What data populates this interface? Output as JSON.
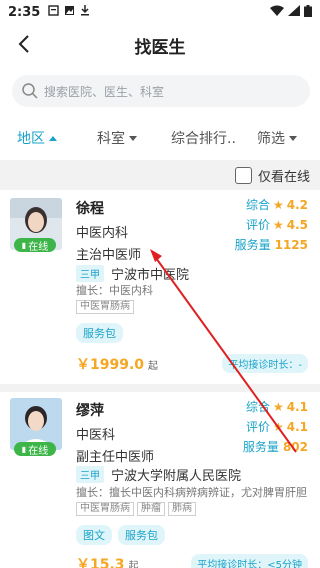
{
  "status_bar": {
    "time": "2:35"
  },
  "header": {
    "title": "找医生"
  },
  "search": {
    "placeholder": "搜索医院、医生、科室"
  },
  "filters": [
    {
      "label": "地区"
    },
    {
      "label": "科室"
    },
    {
      "label": "综合排行.."
    },
    {
      "label": "筛选"
    }
  ],
  "online_filter": {
    "label": "仅看在线"
  },
  "doctors": [
    {
      "name": "徐程",
      "department": "中医内科",
      "title": "主治中医师",
      "hospital_grade": "三甲",
      "hospital": "宁波市中医院",
      "specialty": "擅长：中医内科",
      "tags": [
        "中医胃肠病"
      ],
      "services": [
        "服务包"
      ],
      "price": "￥1999.0",
      "price_unit": "起",
      "avg_time": "平均接诊时长：-",
      "online": "在线",
      "stats": [
        {
          "label": "综合",
          "value": "4.2",
          "star": true
        },
        {
          "label": "评价",
          "value": "4.5",
          "star": true
        },
        {
          "label": "服务量",
          "value": "1125",
          "star": false
        }
      ]
    },
    {
      "name": "缪萍",
      "department": "中医科",
      "title": "副主任中医师",
      "hospital_grade": "三甲",
      "hospital": "宁波大学附属人民医院",
      "specialty": "擅长：擅长中医内科病辨病辨证，尤对脾胃肝胆",
      "tags": [
        "中医胃肠病",
        "肿瘤",
        "肺病"
      ],
      "services": [
        "图文",
        "服务包"
      ],
      "price": "￥15.3",
      "price_unit": "起",
      "avg_time": "平均接诊时长：<5分钟",
      "online": "在线",
      "stats": [
        {
          "label": "综合",
          "value": "4.1",
          "star": true
        },
        {
          "label": "评价",
          "value": "4.1",
          "star": true
        },
        {
          "label": "服务量",
          "value": "802",
          "star": false
        }
      ]
    }
  ]
}
